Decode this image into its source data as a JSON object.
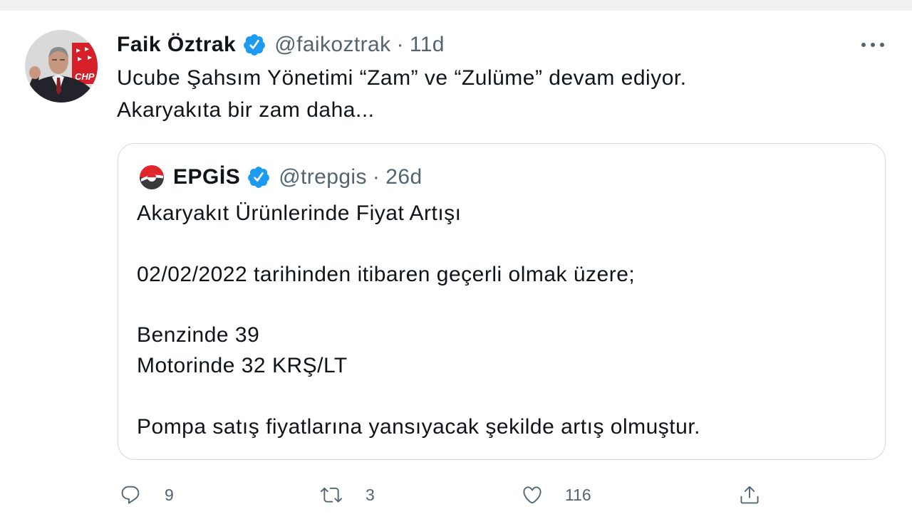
{
  "colors": {
    "text": "#0f1419",
    "secondary": "#536471",
    "verified": "#1d9bf0",
    "border": "#cfd9de",
    "page": "#ffffff",
    "frame": "#eff1f2",
    "party_red": "#d5202a",
    "epgis_red": "#e0262b",
    "epgis_dark": "#3a3a3a"
  },
  "icons": {
    "verified": "verified-badge-icon",
    "more": "more-icon",
    "reply": "reply-icon",
    "retweet": "retweet-icon",
    "like": "heart-icon",
    "share": "share-icon",
    "quote_author_logo": "epgis-logo-icon"
  },
  "tweet": {
    "author": {
      "name": "Faik Öztrak",
      "handle": "@faikoztrak",
      "separator": "·",
      "time": "11d",
      "verified": true,
      "avatar_logo_text": "CHP"
    },
    "text": [
      "Ucube Şahsım Yönetimi “Zam” ve “Zulüme” devam ediyor.",
      "Akaryakıta bir zam daha..."
    ],
    "quote": {
      "author": {
        "name": "EPGİS",
        "handle": "@trepgis",
        "separator": "·",
        "time": "26d",
        "verified": true
      },
      "paragraphs": [
        [
          "Akaryakıt Ürünlerinde Fiyat Artışı"
        ],
        [
          "02/02/2022 tarihinden itibaren geçerli olmak üzere;"
        ],
        [
          "Benzinde 39",
          "Motorinde 32 KRŞ/LT"
        ],
        [
          "Pompa satış fiyatlarına yansıyacak şekilde artış olmuştur."
        ]
      ]
    },
    "actions": {
      "replies": "9",
      "retweets": "3",
      "likes": "116"
    }
  }
}
